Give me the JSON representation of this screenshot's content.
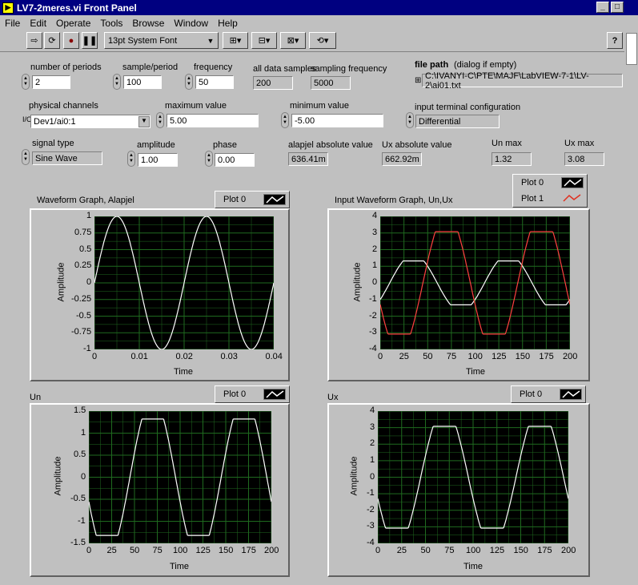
{
  "window": {
    "title": "LV7-2meres.vi Front Panel"
  },
  "menu": [
    "File",
    "Edit",
    "Operate",
    "Tools",
    "Browse",
    "Window",
    "Help"
  ],
  "toolbar": {
    "font": "13pt System Font",
    "help": "?"
  },
  "controls": {
    "number_of_periods": {
      "label": "number of periods",
      "value": "2"
    },
    "sample_per_period": {
      "label": "sample/period",
      "value": "100"
    },
    "frequency": {
      "label": "frequency",
      "value": "50"
    },
    "all_data_samples": {
      "label": "all data samples",
      "value": "200"
    },
    "sampling_frequency": {
      "label": "sampling frequency",
      "value": "5000"
    },
    "file_path": {
      "label": "file path",
      "hint": "(dialog if empty)",
      "value": "C:\\IVANYI-C\\PTE\\MAJF\\LabVIEW-7-1\\LV-2\\ai01.txt"
    },
    "physical_channels": {
      "label": "physical channels",
      "value": "Dev1/ai0:1"
    },
    "maximum_value": {
      "label": "maximum value",
      "value": "5.00"
    },
    "minimum_value": {
      "label": "minimum value",
      "value": "-5.00"
    },
    "input_terminal": {
      "label": "input terminal configuration",
      "value": "Differential"
    },
    "signal_type": {
      "label": "signal type",
      "value": "Sine Wave"
    },
    "amplitude": {
      "label": "amplitude",
      "value": "1.00"
    },
    "phase": {
      "label": "phase",
      "value": "0.00"
    },
    "alapjel_abs": {
      "label": "alapjel absolute value",
      "value": "636.41m"
    },
    "ux_abs": {
      "label": "Ux absolute value",
      "value": "662.92m"
    },
    "un_max": {
      "label": "Un max",
      "value": "1.32"
    },
    "ux_max": {
      "label": "Ux max",
      "value": "3.08"
    }
  },
  "graphs": {
    "g1": {
      "title": "Waveform Graph, Alapjel",
      "xlabel": "Time",
      "ylabel": "Amplitude",
      "legend": [
        "Plot 0"
      ]
    },
    "g2": {
      "title": "Input Waveform Graph, Un,Ux",
      "xlabel": "Time",
      "ylabel": "Amplitude",
      "legend": [
        "Plot 0",
        "Plot 1"
      ]
    },
    "g3": {
      "title": "Un",
      "xlabel": "Time",
      "ylabel": "Amplitude",
      "legend": [
        "Plot 0"
      ]
    },
    "g4": {
      "title": "Ux",
      "xlabel": "Time",
      "ylabel": "Amplitude",
      "legend": [
        "Plot 0"
      ]
    }
  },
  "chart_data": [
    {
      "id": "g1",
      "type": "line",
      "xlim": [
        0,
        0.04
      ],
      "ylim": [
        -1,
        1
      ],
      "xticks": [
        "0",
        "0.01",
        "0.02",
        "0.03",
        "0.04"
      ],
      "yticks": [
        "1",
        "0.75",
        "0.5",
        "0.25",
        "0",
        "-0.25",
        "-0.5",
        "-0.75",
        "-1"
      ],
      "series": [
        {
          "color": "#ffffff",
          "kind": "sine",
          "amp": 1,
          "period": 0.02,
          "offset": 0
        }
      ]
    },
    {
      "id": "g2",
      "type": "line",
      "xlim": [
        0,
        200
      ],
      "ylim": [
        -4,
        4
      ],
      "xticks": [
        "0",
        "25",
        "50",
        "75",
        "100",
        "125",
        "150",
        "175",
        "200"
      ],
      "yticks": [
        "4",
        "3",
        "2",
        "1",
        "0",
        "-1",
        "-2",
        "-3",
        "-4"
      ],
      "series": [
        {
          "color": "#ffffff",
          "kind": "clip",
          "amp": 1.7,
          "clip": 1.32,
          "period": 100,
          "phase": 0.1
        },
        {
          "color": "#ff4040",
          "kind": "clip",
          "amp": 4.2,
          "clip": 3.08,
          "period": 100,
          "phase": 0.45
        }
      ]
    },
    {
      "id": "g3",
      "type": "line",
      "xlim": [
        0,
        200
      ],
      "ylim": [
        -1.5,
        1.5
      ],
      "xticks": [
        "0",
        "25",
        "50",
        "75",
        "100",
        "125",
        "150",
        "175",
        "200"
      ],
      "yticks": [
        "1.5",
        "1",
        "0.5",
        "0",
        "-0.5",
        "-1",
        "-1.5"
      ],
      "series": [
        {
          "color": "#ffffff",
          "kind": "clip",
          "amp": 1.8,
          "clip": 1.32,
          "period": 100,
          "phase": 0.45
        }
      ]
    },
    {
      "id": "g4",
      "type": "line",
      "xlim": [
        0,
        200
      ],
      "ylim": [
        -4,
        4
      ],
      "xticks": [
        "0",
        "25",
        "50",
        "75",
        "100",
        "125",
        "150",
        "175",
        "200"
      ],
      "yticks": [
        "4",
        "3",
        "2",
        "1",
        "0",
        "-1",
        "-2",
        "-3",
        "-4"
      ],
      "series": [
        {
          "color": "#ffffff",
          "kind": "clip",
          "amp": 4.2,
          "clip": 3.08,
          "period": 100,
          "phase": 0.45
        }
      ]
    }
  ],
  "colors": {
    "title_bg": "#000080",
    "panel": "#c0c0c0",
    "grid": "#1f6a1f",
    "plot_bg": "#000000"
  }
}
